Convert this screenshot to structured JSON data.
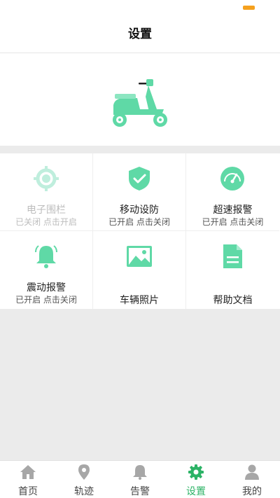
{
  "header": {
    "title": "设置"
  },
  "colors": {
    "accent": "#5fd9a6",
    "active_tab": "#2cb366",
    "battery": "#f5a11e"
  },
  "grid": [
    {
      "icon": "geofence-icon",
      "label": "电子围栏",
      "status": "已关闭 点击开启",
      "enabled": false
    },
    {
      "icon": "shield-check-icon",
      "label": "移动设防",
      "status": "已开启 点击关闭",
      "enabled": true
    },
    {
      "icon": "speedometer-icon",
      "label": "超速报警",
      "status": "已开启 点击关闭",
      "enabled": true
    },
    {
      "icon": "bell-icon",
      "label": "震动报警",
      "status": "已开启 点击关闭",
      "enabled": true
    },
    {
      "icon": "image-icon",
      "label": "车辆照片",
      "status": "",
      "enabled": true
    },
    {
      "icon": "document-icon",
      "label": "帮助文档",
      "status": "",
      "enabled": true
    }
  ],
  "tabs": [
    {
      "icon": "home-icon",
      "label": "首页",
      "active": false
    },
    {
      "icon": "location-pin-icon",
      "label": "轨迹",
      "active": false
    },
    {
      "icon": "bell-icon",
      "label": "告警",
      "active": false
    },
    {
      "icon": "gear-icon",
      "label": "设置",
      "active": true
    },
    {
      "icon": "user-icon",
      "label": "我的",
      "active": false
    }
  ]
}
